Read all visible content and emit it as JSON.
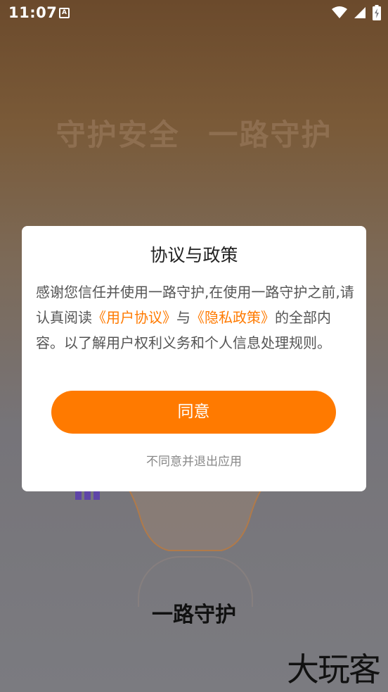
{
  "status_bar": {
    "time": "11:07",
    "notification_icon_letter": "A"
  },
  "hero": {
    "word1": "守护安全",
    "word2": "一路守护"
  },
  "app_name": "一路守护",
  "watermark": "大玩客",
  "dialog": {
    "title": "协议与政策",
    "body_part1": "感谢您信任并使用一路守护,在使用一路守护之前,请认真阅读",
    "user_agreement_link": "《用户协议》",
    "and_text": "与",
    "privacy_policy_link": "《隐私政策》",
    "body_part2": "的全部内容。以了解用户权利义务和个人信息处理规则。",
    "agree_label": "同意",
    "disagree_label": "不同意并退出应用"
  },
  "colors": {
    "accent": "#ff7a00",
    "dialog_bg": "#ffffff"
  }
}
